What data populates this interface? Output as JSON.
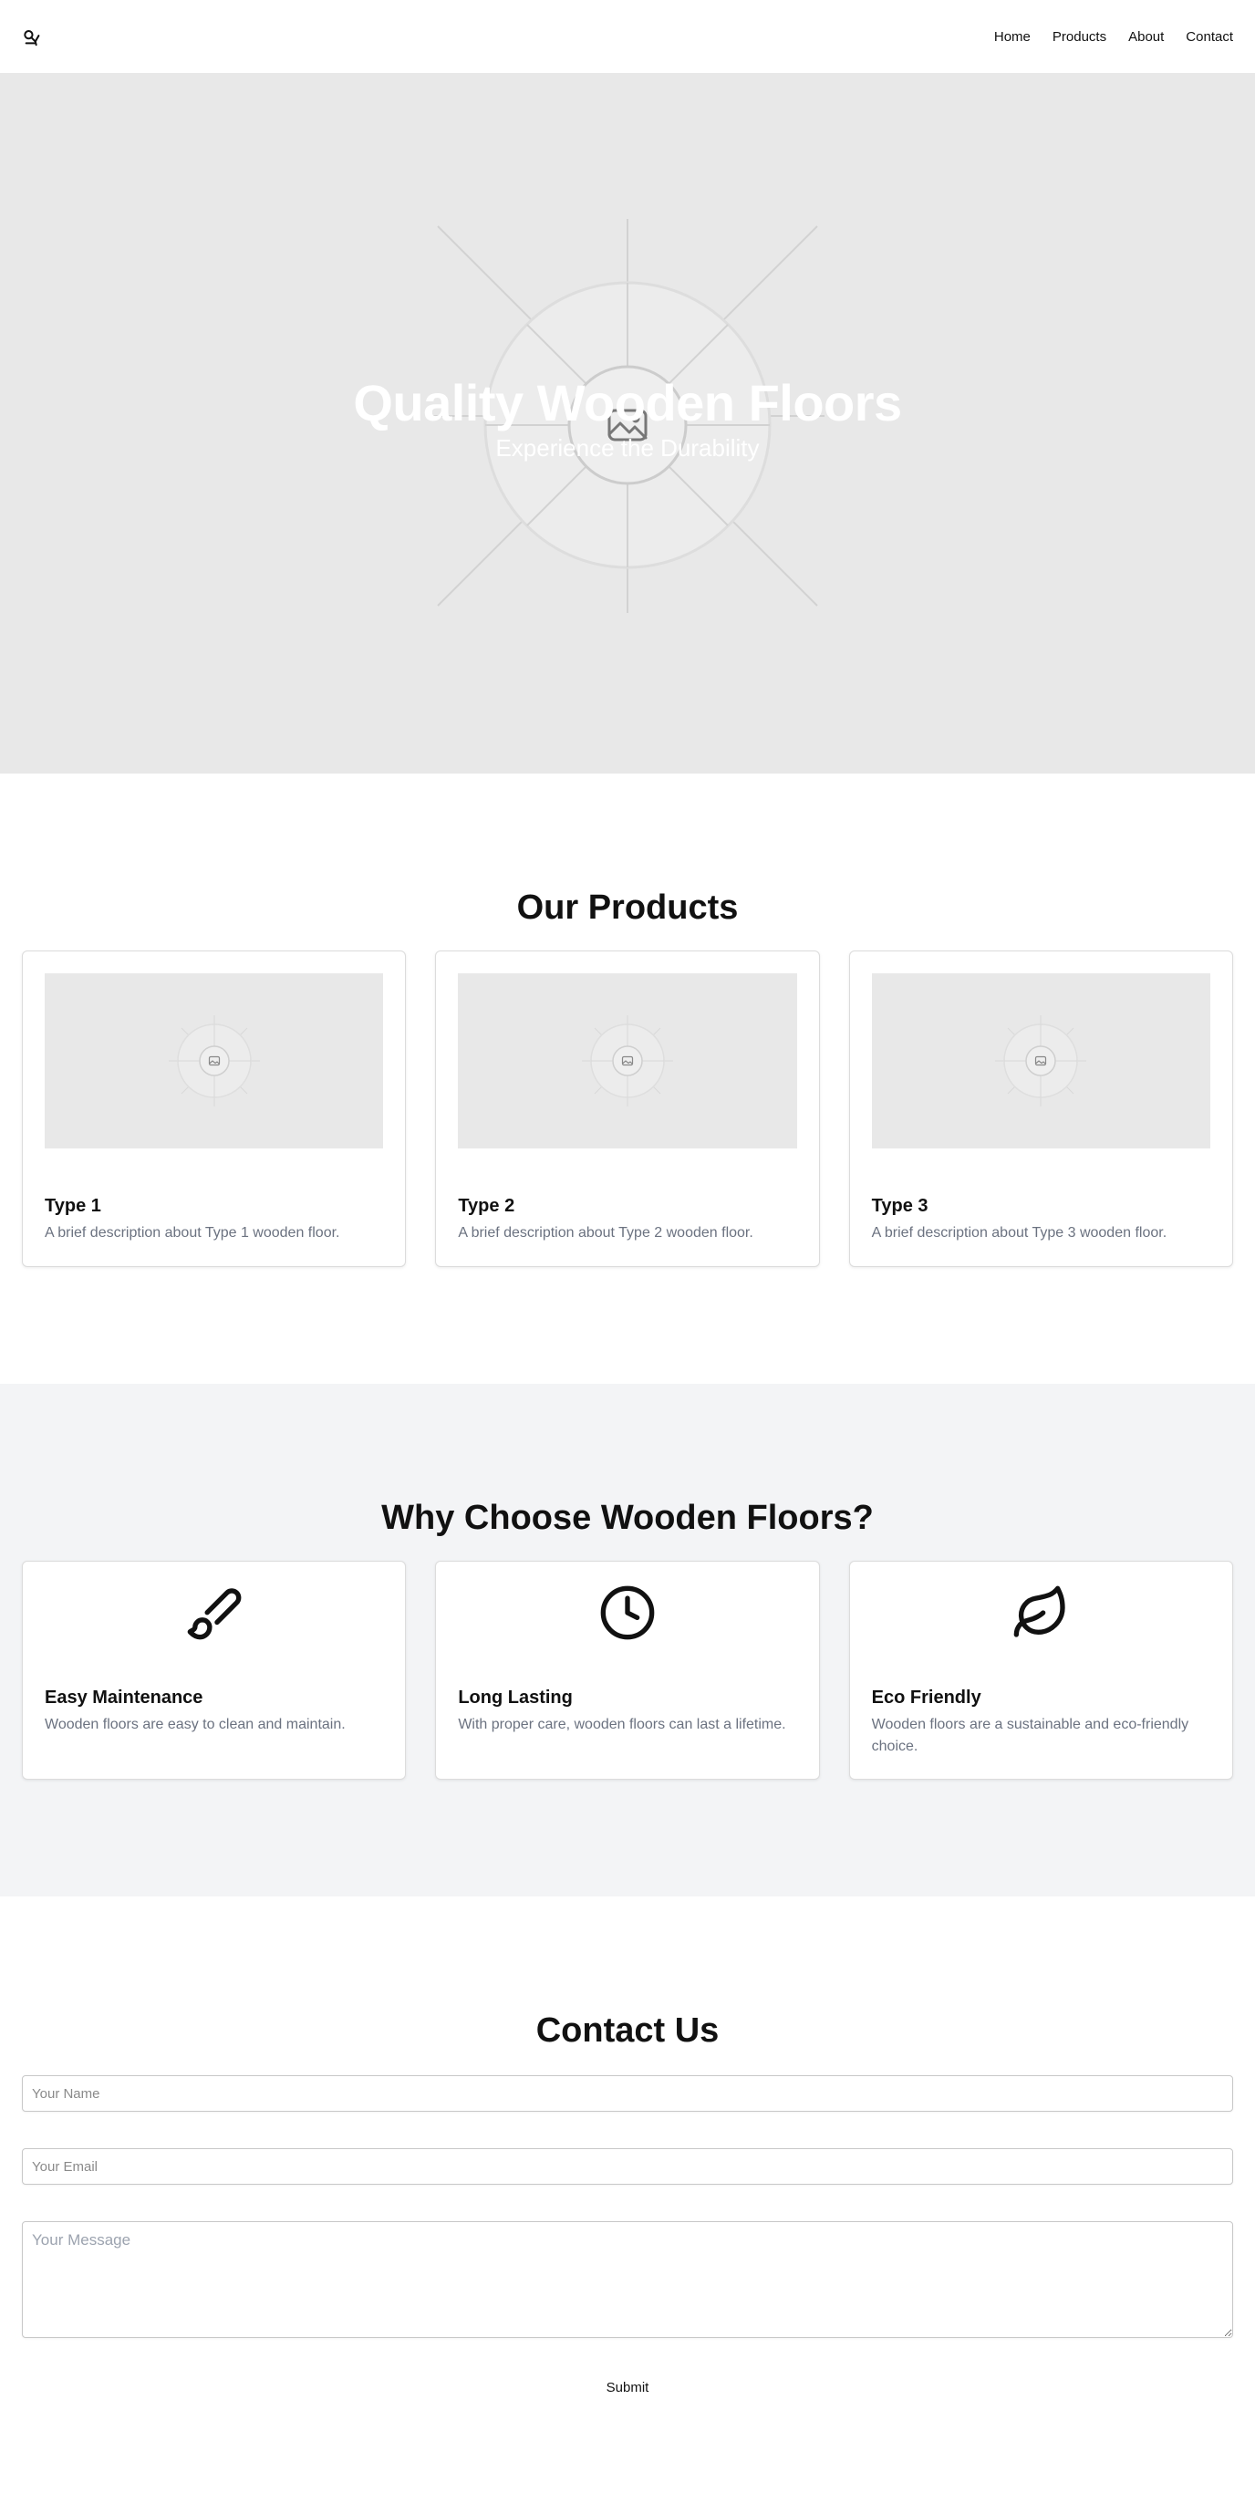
{
  "header": {
    "logo_icon": "tree-logo-icon",
    "nav": [
      {
        "label": "Home"
      },
      {
        "label": "Products"
      },
      {
        "label": "About"
      },
      {
        "label": "Contact"
      }
    ]
  },
  "hero": {
    "title": "Quality Wooden Floors",
    "subtitle": "Experience the Durability",
    "image_icon": "image-placeholder-icon"
  },
  "products": {
    "title": "Our Products",
    "items": [
      {
        "name": "Type 1",
        "description": "A brief description about Type 1 wooden floor."
      },
      {
        "name": "Type 2",
        "description": "A brief description about Type 2 wooden floor."
      },
      {
        "name": "Type 3",
        "description": "A brief description about Type 3 wooden floor."
      }
    ]
  },
  "features": {
    "title": "Why Choose Wooden Floors?",
    "items": [
      {
        "icon": "brush-icon",
        "name": "Easy Maintenance",
        "description": "Wooden floors are easy to clean and maintain."
      },
      {
        "icon": "clock-icon",
        "name": "Long Lasting",
        "description": "With proper care, wooden floors can last a lifetime."
      },
      {
        "icon": "leaf-icon",
        "name": "Eco Friendly",
        "description": "Wooden floors are a sustainable and eco-friendly choice."
      }
    ]
  },
  "contact": {
    "title": "Contact Us",
    "name_placeholder": "Your Name",
    "email_placeholder": "Your Email",
    "message_placeholder": "Your Message",
    "submit_label": "Submit"
  },
  "colors": {
    "placeholder_bg": "#e8e8e8",
    "features_bg": "#f3f4f6",
    "muted_text": "#6b7280"
  }
}
